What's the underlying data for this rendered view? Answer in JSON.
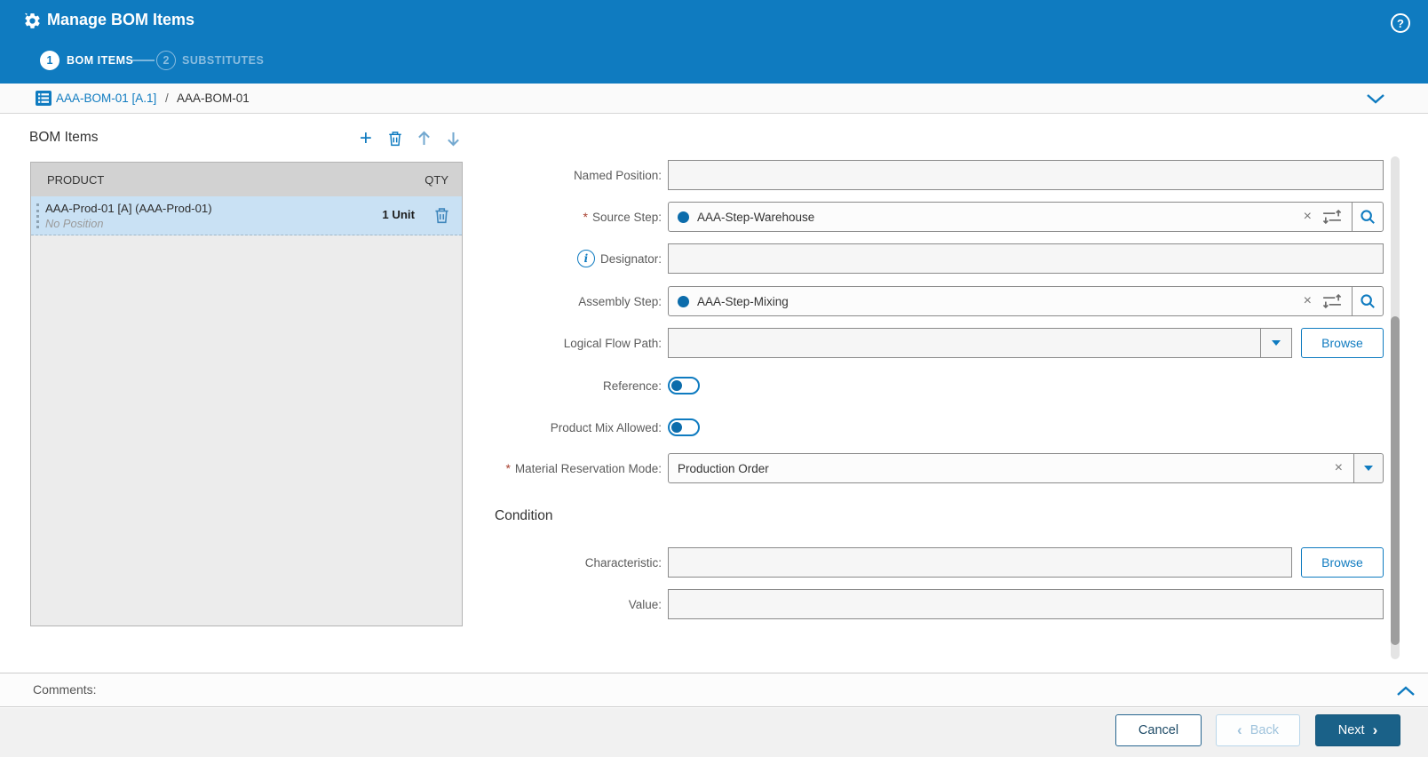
{
  "header": {
    "title": "Manage BOM Items"
  },
  "wizard_steps": [
    {
      "number": "1",
      "label": "BOM ITEMS",
      "active": true
    },
    {
      "number": "2",
      "label": "SUBSTITUTES",
      "active": false
    }
  ],
  "breadcrumb": {
    "root": "AAA-BOM-01 [A.1]",
    "separator": "/",
    "current": "AAA-BOM-01"
  },
  "bom_panel": {
    "title": "BOM Items",
    "columns": {
      "product": "PRODUCT",
      "qty": "QTY"
    },
    "rows": [
      {
        "product": "AAA-Prod-01 [A] (AAA-Prod-01)",
        "position": "No Position",
        "qty": "1 Unit",
        "selected": true
      }
    ]
  },
  "form": {
    "required_marker": "*",
    "named_position": {
      "label": "Named Position:",
      "value": ""
    },
    "source_step": {
      "label": "Source Step:",
      "value": "AAA-Step-Warehouse",
      "required": true
    },
    "designator": {
      "label": "Designator:",
      "value": ""
    },
    "assembly_step": {
      "label": "Assembly Step:",
      "value": "AAA-Step-Mixing"
    },
    "logical_flow_path": {
      "label": "Logical Flow Path:",
      "value": "",
      "browse": "Browse"
    },
    "reference": {
      "label": "Reference:",
      "state": "off"
    },
    "product_mix_allowed": {
      "label": "Product Mix Allowed:",
      "state": "off"
    },
    "material_reservation_mode": {
      "label": "Material Reservation Mode:",
      "value": "Production Order",
      "required": true
    },
    "condition_title": "Condition",
    "characteristic": {
      "label": "Characteristic:",
      "value": "",
      "browse": "Browse"
    },
    "value": {
      "label": "Value:",
      "value": ""
    }
  },
  "comments": {
    "label": "Comments:"
  },
  "footer": {
    "cancel": "Cancel",
    "back": "Back",
    "next": "Next",
    "back_chevron": "‹",
    "next_chevron": "›"
  },
  "help": {
    "glyph": "?"
  },
  "icons": {
    "header": "gear-icon",
    "help": "help-icon",
    "breadcrumb": "bom-table-icon",
    "toolbar": [
      "add-icon",
      "trash-icon",
      "move-up-icon",
      "move-down-icon"
    ],
    "picker": [
      "clear-x-icon",
      "pick-sort-icon",
      "search-icon"
    ],
    "dropdown": "caret-down-icon",
    "collapse": [
      "chevron-down-icon",
      "chevron-up-icon"
    ]
  },
  "colors": {
    "header_blue": "#0f7bc0",
    "accent": "#0f7bc0",
    "selected_row": "#c9e1f4",
    "next_button": "#1a6188",
    "required": "#a8402f",
    "table_header": "#d2d2d2",
    "panel_bg": "#ececec"
  }
}
